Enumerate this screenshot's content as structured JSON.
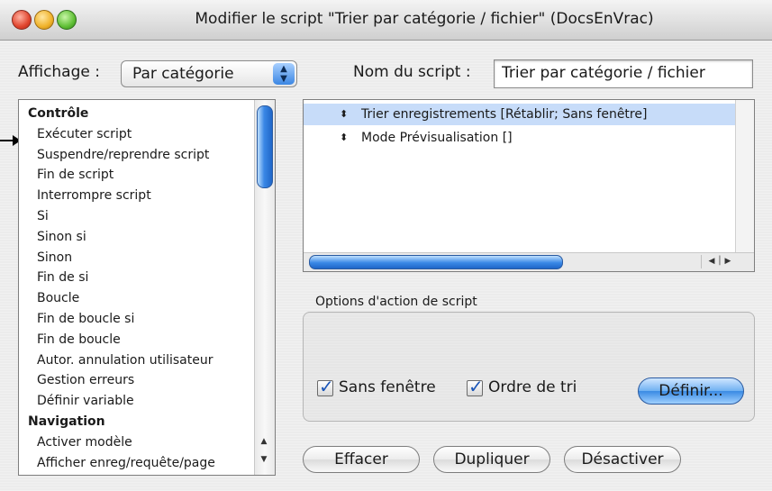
{
  "window": {
    "title": "Modifier le script \"Trier par catégorie / fichier\" (DocsEnVrac)"
  },
  "view": {
    "label": "Affichage :",
    "selected": "Par catégorie"
  },
  "script_name": {
    "label": "Nom du script :",
    "value": "Trier par catégorie / fichier"
  },
  "steps_list": [
    {
      "label": "Contrôle",
      "category": true
    },
    {
      "label": "Exécuter script",
      "category": false
    },
    {
      "label": "Suspendre/reprendre script",
      "category": false
    },
    {
      "label": "Fin de script",
      "category": false
    },
    {
      "label": "Interrompre script",
      "category": false
    },
    {
      "label": "Si",
      "category": false
    },
    {
      "label": "Sinon si",
      "category": false
    },
    {
      "label": "Sinon",
      "category": false
    },
    {
      "label": "Fin de si",
      "category": false
    },
    {
      "label": "Boucle",
      "category": false
    },
    {
      "label": "Fin de boucle si",
      "category": false
    },
    {
      "label": "Fin de boucle",
      "category": false
    },
    {
      "label": "Autor. annulation utilisateur",
      "category": false
    },
    {
      "label": "Gestion erreurs",
      "category": false
    },
    {
      "label": "Définir variable",
      "category": false
    },
    {
      "label": "Navigation",
      "category": true
    },
    {
      "label": "Activer modèle",
      "category": false
    },
    {
      "label": "Afficher enreg/requête/page",
      "category": false
    }
  ],
  "script_steps": [
    {
      "text": "Trier enregistrements [Rétablir; Sans fenêtre]",
      "selected": true
    },
    {
      "text": "Mode Prévisualisation []",
      "selected": false
    }
  ],
  "options": {
    "group_label": "Options d'action de script",
    "no_dialog": {
      "label": "Sans fenêtre",
      "checked": true
    },
    "sort_order": {
      "label": "Ordre de tri",
      "checked": true
    },
    "define_button": "Définir..."
  },
  "buttons": {
    "clear": "Effacer",
    "duplicate": "Dupliquer",
    "disable": "Désactiver"
  },
  "colors": {
    "selection": "#c7dcf9",
    "aqua_blue": "#3a88e6",
    "check_blue": "#1b56b8"
  }
}
